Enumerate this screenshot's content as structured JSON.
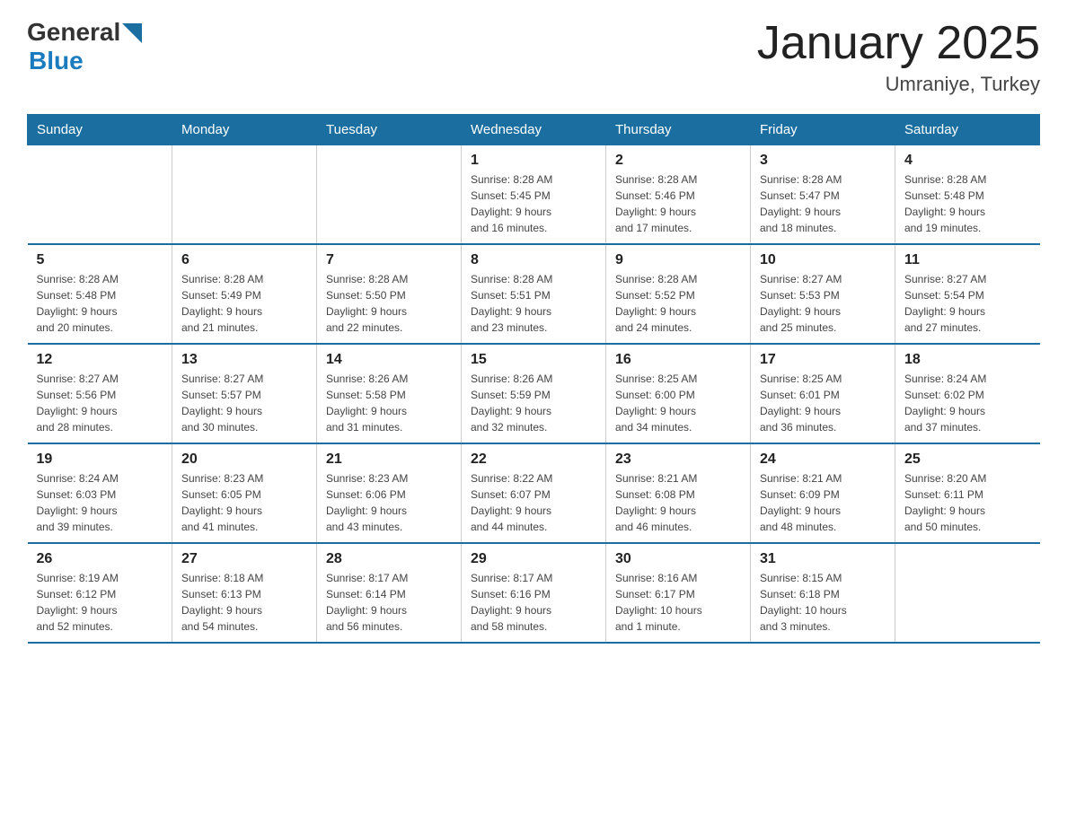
{
  "logo": {
    "general": "General",
    "blue": "Blue",
    "arrow": "▶"
  },
  "title": "January 2025",
  "subtitle": "Umraniye, Turkey",
  "headers": [
    "Sunday",
    "Monday",
    "Tuesday",
    "Wednesday",
    "Thursday",
    "Friday",
    "Saturday"
  ],
  "weeks": [
    [
      {
        "day": "",
        "info": ""
      },
      {
        "day": "",
        "info": ""
      },
      {
        "day": "",
        "info": ""
      },
      {
        "day": "1",
        "info": "Sunrise: 8:28 AM\nSunset: 5:45 PM\nDaylight: 9 hours\nand 16 minutes."
      },
      {
        "day": "2",
        "info": "Sunrise: 8:28 AM\nSunset: 5:46 PM\nDaylight: 9 hours\nand 17 minutes."
      },
      {
        "day": "3",
        "info": "Sunrise: 8:28 AM\nSunset: 5:47 PM\nDaylight: 9 hours\nand 18 minutes."
      },
      {
        "day": "4",
        "info": "Sunrise: 8:28 AM\nSunset: 5:48 PM\nDaylight: 9 hours\nand 19 minutes."
      }
    ],
    [
      {
        "day": "5",
        "info": "Sunrise: 8:28 AM\nSunset: 5:48 PM\nDaylight: 9 hours\nand 20 minutes."
      },
      {
        "day": "6",
        "info": "Sunrise: 8:28 AM\nSunset: 5:49 PM\nDaylight: 9 hours\nand 21 minutes."
      },
      {
        "day": "7",
        "info": "Sunrise: 8:28 AM\nSunset: 5:50 PM\nDaylight: 9 hours\nand 22 minutes."
      },
      {
        "day": "8",
        "info": "Sunrise: 8:28 AM\nSunset: 5:51 PM\nDaylight: 9 hours\nand 23 minutes."
      },
      {
        "day": "9",
        "info": "Sunrise: 8:28 AM\nSunset: 5:52 PM\nDaylight: 9 hours\nand 24 minutes."
      },
      {
        "day": "10",
        "info": "Sunrise: 8:27 AM\nSunset: 5:53 PM\nDaylight: 9 hours\nand 25 minutes."
      },
      {
        "day": "11",
        "info": "Sunrise: 8:27 AM\nSunset: 5:54 PM\nDaylight: 9 hours\nand 27 minutes."
      }
    ],
    [
      {
        "day": "12",
        "info": "Sunrise: 8:27 AM\nSunset: 5:56 PM\nDaylight: 9 hours\nand 28 minutes."
      },
      {
        "day": "13",
        "info": "Sunrise: 8:27 AM\nSunset: 5:57 PM\nDaylight: 9 hours\nand 30 minutes."
      },
      {
        "day": "14",
        "info": "Sunrise: 8:26 AM\nSunset: 5:58 PM\nDaylight: 9 hours\nand 31 minutes."
      },
      {
        "day": "15",
        "info": "Sunrise: 8:26 AM\nSunset: 5:59 PM\nDaylight: 9 hours\nand 32 minutes."
      },
      {
        "day": "16",
        "info": "Sunrise: 8:25 AM\nSunset: 6:00 PM\nDaylight: 9 hours\nand 34 minutes."
      },
      {
        "day": "17",
        "info": "Sunrise: 8:25 AM\nSunset: 6:01 PM\nDaylight: 9 hours\nand 36 minutes."
      },
      {
        "day": "18",
        "info": "Sunrise: 8:24 AM\nSunset: 6:02 PM\nDaylight: 9 hours\nand 37 minutes."
      }
    ],
    [
      {
        "day": "19",
        "info": "Sunrise: 8:24 AM\nSunset: 6:03 PM\nDaylight: 9 hours\nand 39 minutes."
      },
      {
        "day": "20",
        "info": "Sunrise: 8:23 AM\nSunset: 6:05 PM\nDaylight: 9 hours\nand 41 minutes."
      },
      {
        "day": "21",
        "info": "Sunrise: 8:23 AM\nSunset: 6:06 PM\nDaylight: 9 hours\nand 43 minutes."
      },
      {
        "day": "22",
        "info": "Sunrise: 8:22 AM\nSunset: 6:07 PM\nDaylight: 9 hours\nand 44 minutes."
      },
      {
        "day": "23",
        "info": "Sunrise: 8:21 AM\nSunset: 6:08 PM\nDaylight: 9 hours\nand 46 minutes."
      },
      {
        "day": "24",
        "info": "Sunrise: 8:21 AM\nSunset: 6:09 PM\nDaylight: 9 hours\nand 48 minutes."
      },
      {
        "day": "25",
        "info": "Sunrise: 8:20 AM\nSunset: 6:11 PM\nDaylight: 9 hours\nand 50 minutes."
      }
    ],
    [
      {
        "day": "26",
        "info": "Sunrise: 8:19 AM\nSunset: 6:12 PM\nDaylight: 9 hours\nand 52 minutes."
      },
      {
        "day": "27",
        "info": "Sunrise: 8:18 AM\nSunset: 6:13 PM\nDaylight: 9 hours\nand 54 minutes."
      },
      {
        "day": "28",
        "info": "Sunrise: 8:17 AM\nSunset: 6:14 PM\nDaylight: 9 hours\nand 56 minutes."
      },
      {
        "day": "29",
        "info": "Sunrise: 8:17 AM\nSunset: 6:16 PM\nDaylight: 9 hours\nand 58 minutes."
      },
      {
        "day": "30",
        "info": "Sunrise: 8:16 AM\nSunset: 6:17 PM\nDaylight: 10 hours\nand 1 minute."
      },
      {
        "day": "31",
        "info": "Sunrise: 8:15 AM\nSunset: 6:18 PM\nDaylight: 10 hours\nand 3 minutes."
      },
      {
        "day": "",
        "info": ""
      }
    ]
  ]
}
